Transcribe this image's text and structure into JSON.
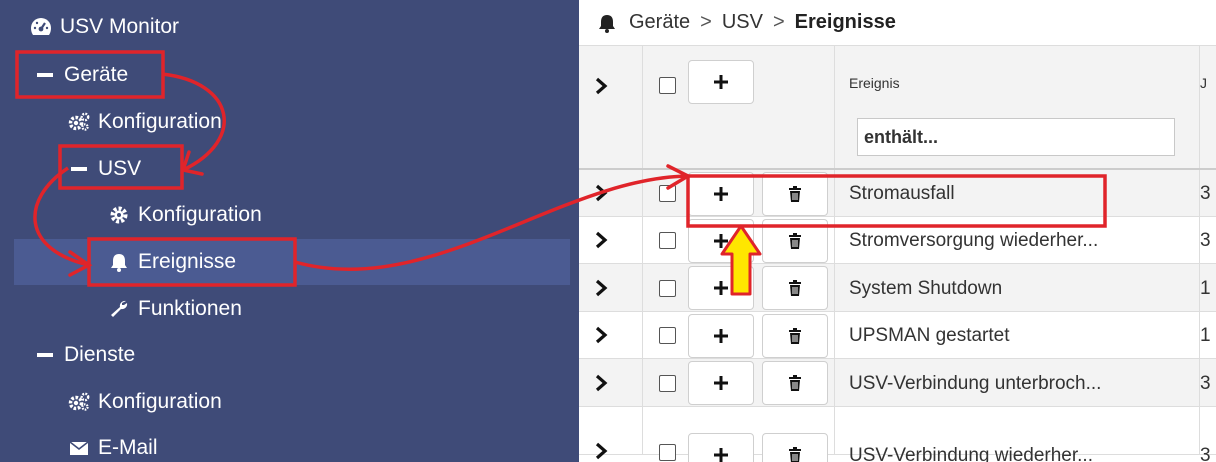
{
  "sidebar": {
    "title": "USV Monitor",
    "items": [
      {
        "label": "Geräte"
      },
      {
        "label": "Konfiguration"
      },
      {
        "label": "USV"
      },
      {
        "label": "Konfiguration"
      },
      {
        "label": "Ereignisse"
      },
      {
        "label": "Funktionen"
      },
      {
        "label": "Dienste"
      },
      {
        "label": "Konfiguration"
      },
      {
        "label": "E-Mail"
      }
    ]
  },
  "breadcrumb": {
    "part1": "Geräte",
    "sep1": ">",
    "part2": "USV",
    "sep2": ">",
    "current": "Ereignisse"
  },
  "table": {
    "column_event": "Ereignis",
    "column_next": "J",
    "filter_placeholder": "enthält...",
    "rows": [
      {
        "event": "Stromausfall",
        "j": "3"
      },
      {
        "event": "Stromversorgung wiederher...",
        "j": "3"
      },
      {
        "event": "System Shutdown",
        "j": "1"
      },
      {
        "event": "UPSMAN gestartet",
        "j": "1"
      },
      {
        "event": "USV-Verbindung unterbroch...",
        "j": "3"
      },
      {
        "event": "USV-Verbindung wiederher...",
        "j": "3"
      }
    ]
  },
  "colors": {
    "sidebar_bg": "#3f4b78",
    "sidebar_active": "#4b5b92",
    "annotation_red": "#e0242a",
    "highlight_arrow": "#ffe600"
  }
}
